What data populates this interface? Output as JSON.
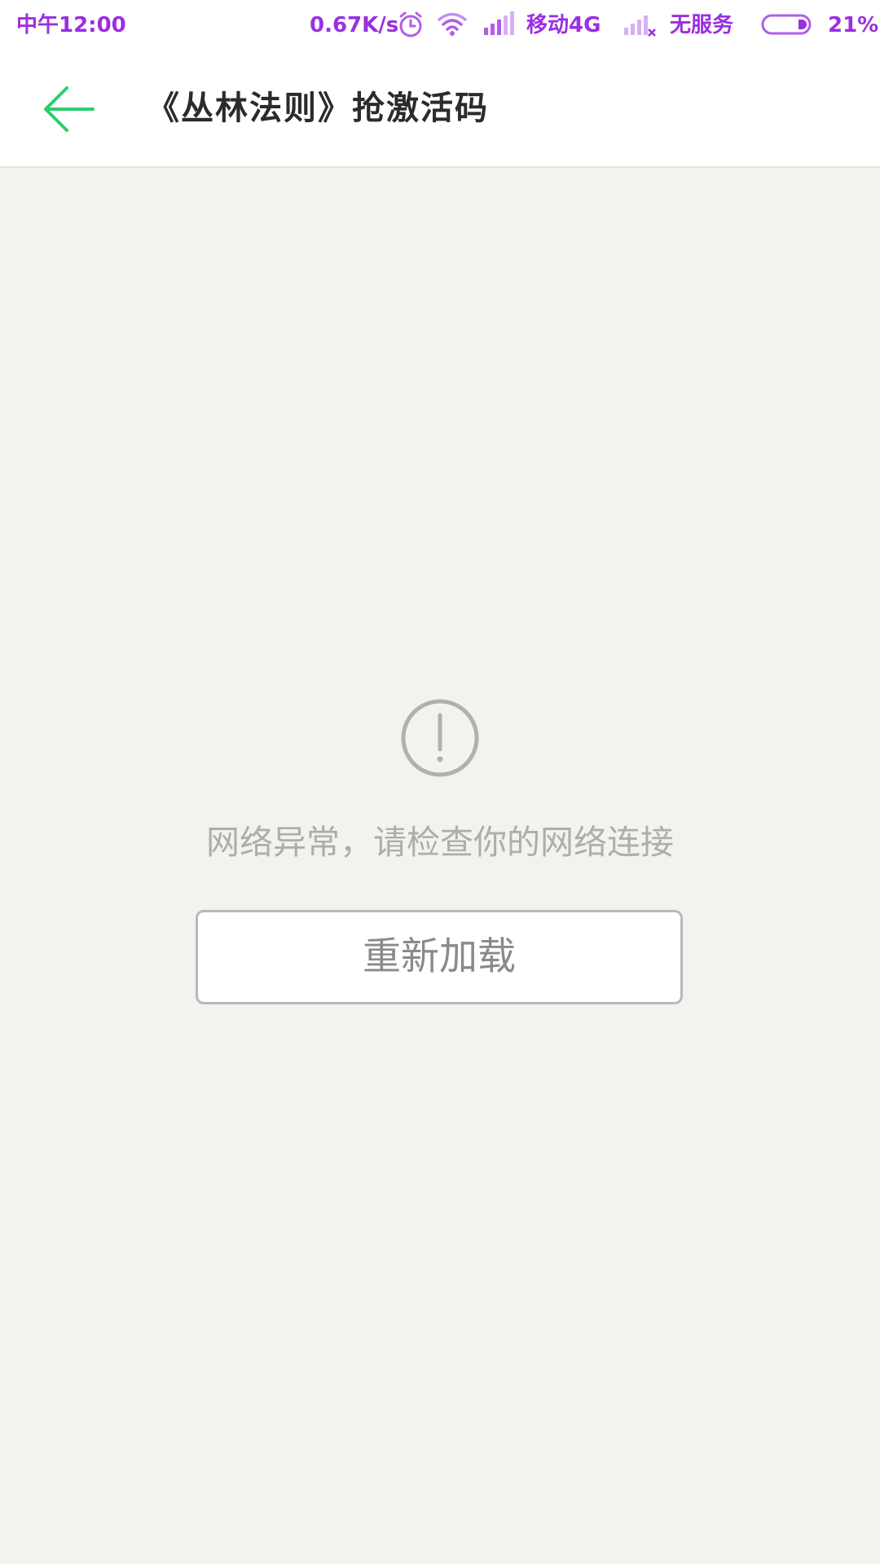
{
  "status_bar": {
    "time": "中午12:00",
    "net_speed": "0.67K/s",
    "carrier": "移动4G",
    "secondary_sim": "无服务",
    "battery_percent": "21%",
    "icons": [
      "alarm-icon",
      "wifi-icon",
      "signal-icon",
      "no-signal-icon",
      "battery-icon"
    ],
    "accent_color": "#9b2fe0"
  },
  "app_bar": {
    "title": "《丛林法则》抢激活码",
    "back_icon": "arrow-left-icon",
    "back_color": "#2ecc71"
  },
  "error": {
    "icon": "exclamation-circle-icon",
    "message": "网络异常，请检查你的网络连接",
    "reload_label": "重新加载"
  }
}
